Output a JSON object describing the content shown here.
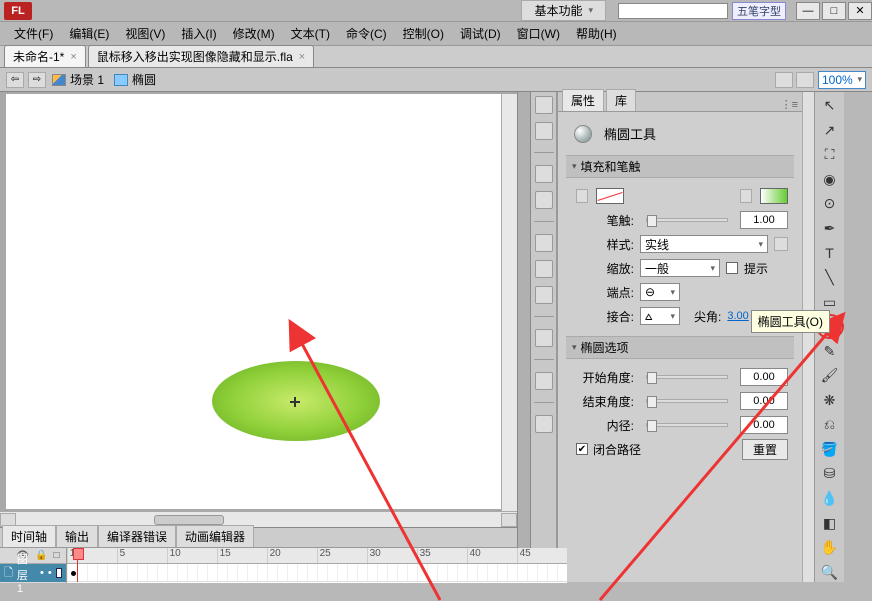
{
  "app": {
    "logo": "FL"
  },
  "title": {
    "workspace": "基本功能",
    "ime": "五笔字型"
  },
  "winbtns": {
    "min": "—",
    "max": "□",
    "close": "✕"
  },
  "menus": [
    "文件(F)",
    "编辑(E)",
    "视图(V)",
    "插入(I)",
    "修改(M)",
    "文本(T)",
    "命令(C)",
    "控制(O)",
    "调试(D)",
    "窗口(W)",
    "帮助(H)"
  ],
  "tabs": [
    {
      "label": "未命名-1*",
      "active": true
    },
    {
      "label": "鼠标移入移出实现图像隐藏和显示.fla",
      "active": false
    }
  ],
  "editbar": {
    "scene": "场景 1",
    "symbol": "椭圆",
    "zoom": "100%"
  },
  "bottomTabs": [
    "时间轴",
    "输出",
    "编译器错误",
    "动画编辑器"
  ],
  "layer": {
    "name": "图层 1"
  },
  "frameTicks": [
    "1",
    "5",
    "10",
    "15",
    "20",
    "25",
    "30",
    "35",
    "40",
    "45"
  ],
  "prop": {
    "tabs": [
      "属性",
      "库"
    ],
    "toolName": "椭圆工具",
    "sections": {
      "fillStroke": {
        "title": "填充和笔触",
        "strokeLbl": "笔触:",
        "strokeVal": "1.00",
        "styleLbl": "样式:",
        "styleVal": "实线",
        "scaleLbl": "缩放:",
        "scaleVal": "一般",
        "hintLbl": "提示",
        "capLbl": "端点:",
        "joinLbl": "接合:",
        "miterLbl": "尖角:",
        "miterVal": "3.00"
      },
      "oval": {
        "title": "椭圆选项",
        "startLbl": "开始角度:",
        "startVal": "0.00",
        "endLbl": "结束角度:",
        "endVal": "0.00",
        "innerLbl": "内径:",
        "innerVal": "0.00",
        "closeLbl": "闭合路径",
        "resetLbl": "重置"
      }
    }
  },
  "tooltip": "椭圆工具(O)",
  "tools": [
    {
      "name": "selection",
      "glyph": "↖"
    },
    {
      "name": "subselection",
      "glyph": "↗"
    },
    {
      "name": "free-transform",
      "glyph": "⛶"
    },
    {
      "name": "3d-rotation",
      "glyph": "◉"
    },
    {
      "name": "lasso",
      "glyph": "⊙"
    },
    {
      "name": "pen",
      "glyph": "✒"
    },
    {
      "name": "text",
      "glyph": "T"
    },
    {
      "name": "line",
      "glyph": "╲"
    },
    {
      "name": "rectangle",
      "glyph": "▭"
    },
    {
      "name": "oval",
      "glyph": "○",
      "hl": true
    },
    {
      "name": "pencil",
      "glyph": "✎"
    },
    {
      "name": "brush",
      "glyph": "🖌"
    },
    {
      "name": "deco",
      "glyph": "❋"
    },
    {
      "name": "bone",
      "glyph": "⎌"
    },
    {
      "name": "paint-bucket",
      "glyph": "🪣"
    },
    {
      "name": "ink-bottle",
      "glyph": "⛁"
    },
    {
      "name": "eyedropper",
      "glyph": "💧"
    },
    {
      "name": "eraser",
      "glyph": "◧"
    },
    {
      "name": "hand",
      "glyph": "✋"
    },
    {
      "name": "zoom",
      "glyph": "🔍"
    }
  ]
}
